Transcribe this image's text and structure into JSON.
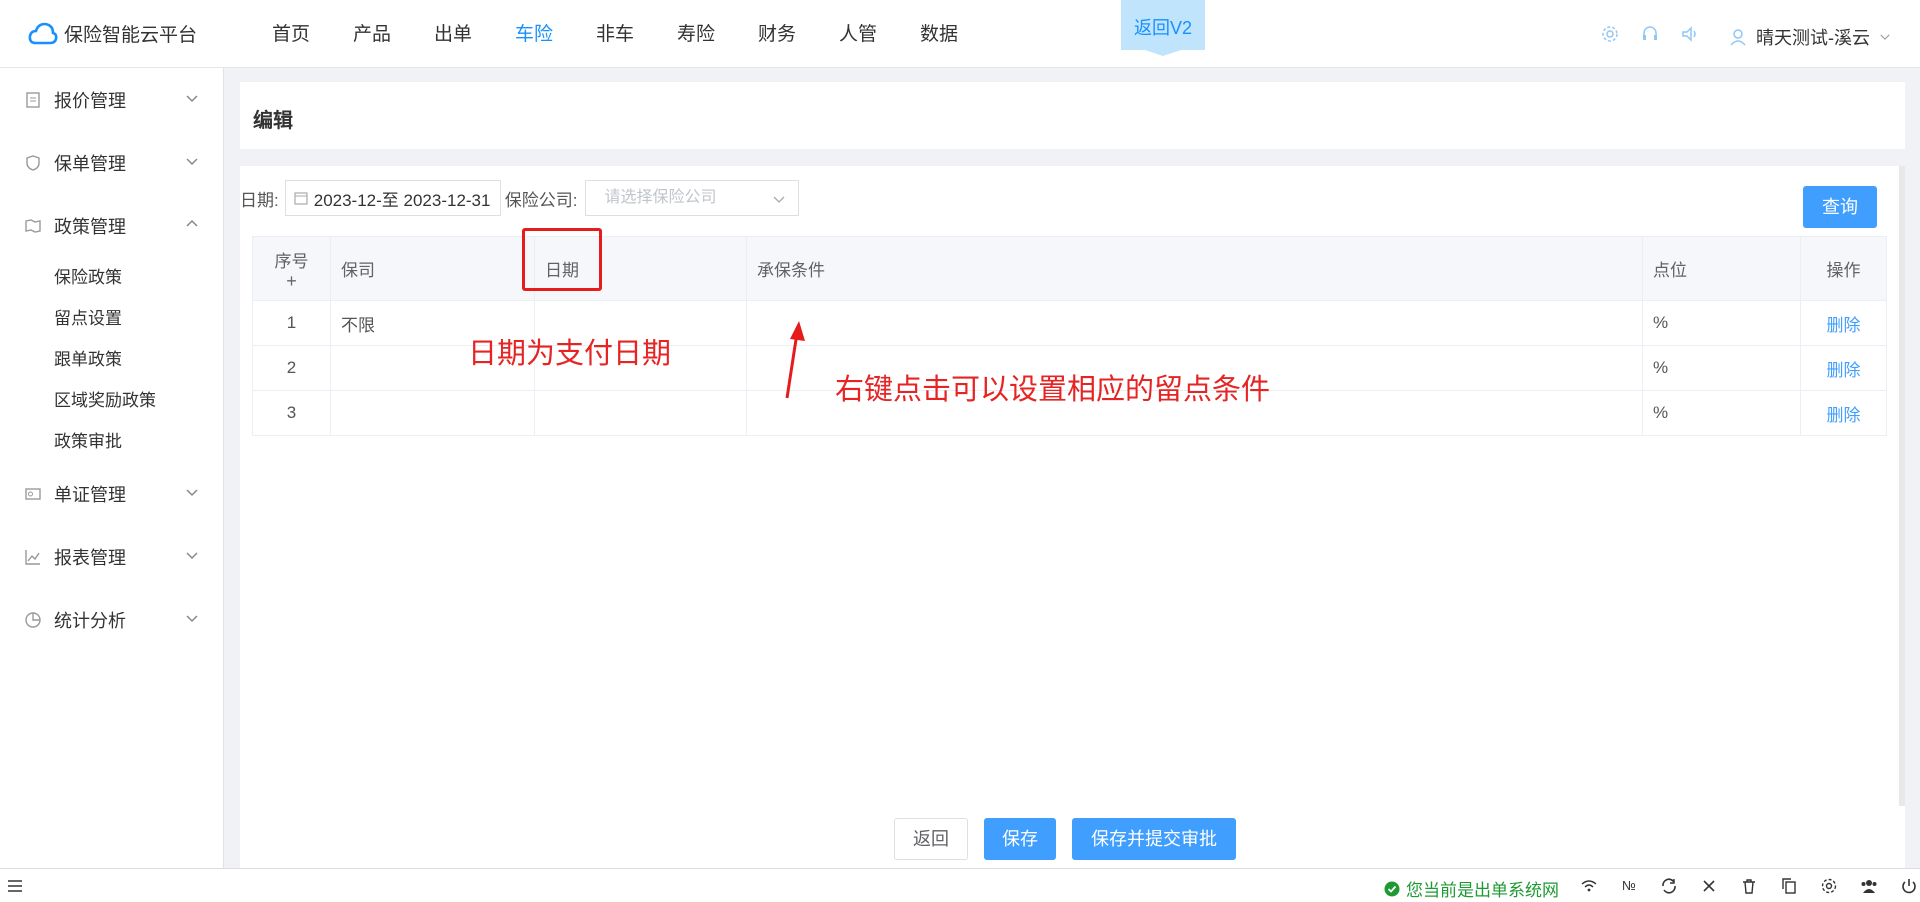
{
  "header": {
    "logo_text": "保险智能云平台",
    "nav": [
      "首页",
      "产品",
      "出单",
      "车险",
      "非车",
      "寿险",
      "财务",
      "人管",
      "数据"
    ],
    "active_nav": "车险",
    "return_v2": "返回V2",
    "user_name": "晴天测试-溪云"
  },
  "sidebar": {
    "groups": [
      {
        "label": "报价管理",
        "icon": "clipboard-icon"
      },
      {
        "label": "保单管理",
        "icon": "shield-icon"
      },
      {
        "label": "政策管理",
        "icon": "policy-icon"
      },
      {
        "label": "单证管理",
        "icon": "id-card-icon"
      },
      {
        "label": "报表管理",
        "icon": "chart-icon"
      },
      {
        "label": "统计分析",
        "icon": "pie-icon"
      }
    ],
    "policy_sub": [
      "保险政策",
      "留点设置",
      "跟单政策",
      "区域奖励政策",
      "政策审批"
    ]
  },
  "page": {
    "title": "编辑"
  },
  "filter": {
    "date_label": "日期:",
    "date_range": "2023-12-至 2023-12-31",
    "company_label": "保险公司:",
    "company_placeholder": "请选择保险公司",
    "query_button": "查询"
  },
  "table": {
    "headers": {
      "seq": "序号",
      "plus": "+",
      "insurer": "保司",
      "date": "日期",
      "conditions": "承保条件",
      "points": "点位",
      "action": "操作"
    },
    "rows": [
      {
        "seq": "1",
        "insurer": "不限",
        "date": "",
        "conditions": "",
        "points": "%",
        "action": "删除"
      },
      {
        "seq": "2",
        "insurer": "",
        "date": "",
        "conditions": "",
        "points": "%",
        "action": "删除"
      },
      {
        "seq": "3",
        "insurer": "",
        "date": "",
        "conditions": "",
        "points": "%",
        "action": "删除"
      }
    ]
  },
  "annotations": {
    "note1": "日期为支付日期",
    "note2": "右键点击可以设置相应的留点条件"
  },
  "footer": {
    "back": "返回",
    "save": "保存",
    "save_submit": "保存并提交审批"
  },
  "statusbar": {
    "status_text": "您当前是出单系统网",
    "icons": [
      "wifi-icon",
      "number-icon",
      "refresh-icon",
      "close-icon",
      "trash-icon",
      "copy-icon",
      "settings-icon",
      "users-icon",
      "power-icon"
    ]
  }
}
